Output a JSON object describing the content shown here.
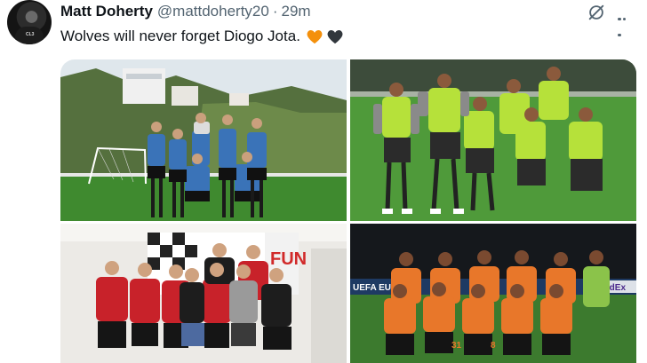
{
  "author": {
    "name": "Matt Doherty",
    "handle": "@mattdoherty20",
    "separator": "·",
    "time": "29m"
  },
  "avatar_badge": "CL3",
  "tweet": {
    "text": "Wolves will never forget Diogo Jota.",
    "emojis": [
      "orange-heart",
      "black-heart"
    ]
  },
  "icons": {
    "grok": "slashed-circle-icon",
    "more": "more-dots-icon"
  },
  "colors": {
    "orange_heart": "#f4900c",
    "black_heart": "#31373d",
    "muted_text": "#536471",
    "wolves_orange": "#e8772a",
    "bib_green": "#b6e13a"
  },
  "photos": [
    {
      "id": "training-beach",
      "board_text": ""
    },
    {
      "id": "training-bibs",
      "board_text": ""
    },
    {
      "id": "red-shirts-group",
      "board_text": "FUN"
    },
    {
      "id": "europa-team-photo",
      "board_text": "UEFA EUROPA",
      "board_text2": "FedEx",
      "numbers": [
        "31",
        "8"
      ]
    }
  ]
}
